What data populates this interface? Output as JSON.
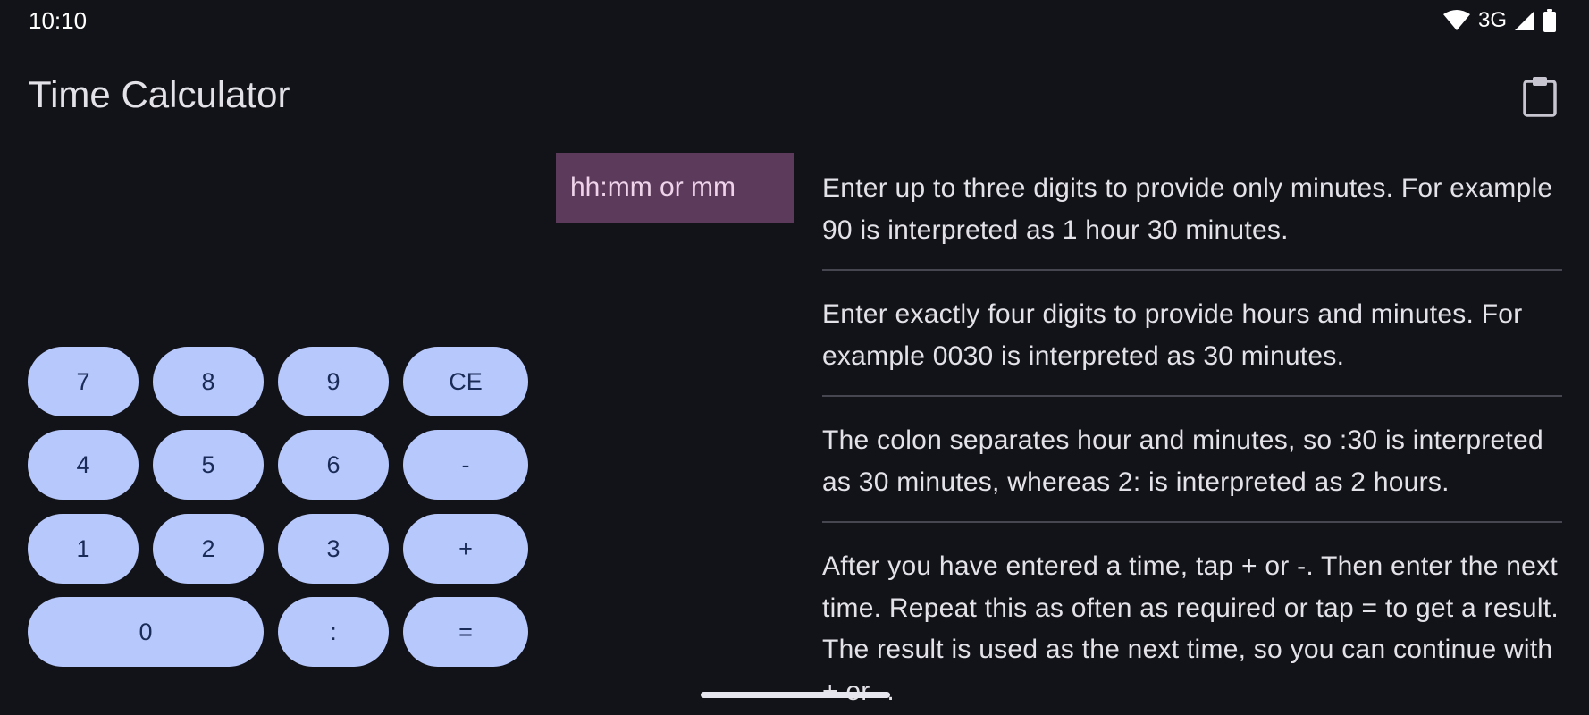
{
  "status_bar": {
    "time": "10:10",
    "network": "3G",
    "icons": [
      "wifi-icon",
      "cell-signal-icon",
      "battery-icon"
    ]
  },
  "app_bar": {
    "title": "Time Calculator",
    "action_icon": "clipboard-icon"
  },
  "input": {
    "value": "",
    "placeholder": "hh:mm or mm"
  },
  "keypad": {
    "keys": [
      {
        "id": "7",
        "label": "7"
      },
      {
        "id": "8",
        "label": "8"
      },
      {
        "id": "9",
        "label": "9"
      },
      {
        "id": "ce",
        "label": "CE"
      },
      {
        "id": "4",
        "label": "4"
      },
      {
        "id": "5",
        "label": "5"
      },
      {
        "id": "6",
        "label": "6"
      },
      {
        "id": "minus",
        "label": "-"
      },
      {
        "id": "1",
        "label": "1"
      },
      {
        "id": "2",
        "label": "2"
      },
      {
        "id": "3",
        "label": "3"
      },
      {
        "id": "plus",
        "label": "+"
      },
      {
        "id": "0",
        "label": "0"
      },
      {
        "id": "colon",
        "label": ":"
      },
      {
        "id": "equals",
        "label": "="
      }
    ]
  },
  "help": {
    "paragraphs": [
      "Enter up to three digits to provide only minutes. For example 90 is interpreted as 1 hour 30 minutes.",
      "Enter exactly four digits to provide hours and minutes. For example 0030 is interpreted as 30 minutes.",
      "The colon separates hour and minutes, so :30 is interpreted as 30 minutes, whereas 2: is interpreted as 2 hours.",
      "After you have entered a time, tap + or -. Then enter the next time. Repeat this as often as required or tap = to get a result. The result is used as the next time, so you can continue with + or -."
    ]
  },
  "colors": {
    "background": "#121318",
    "key_background": "#b7c8fc",
    "key_text": "#1b2b57",
    "input_background": "#5c3a5b",
    "divider": "#45464f"
  }
}
